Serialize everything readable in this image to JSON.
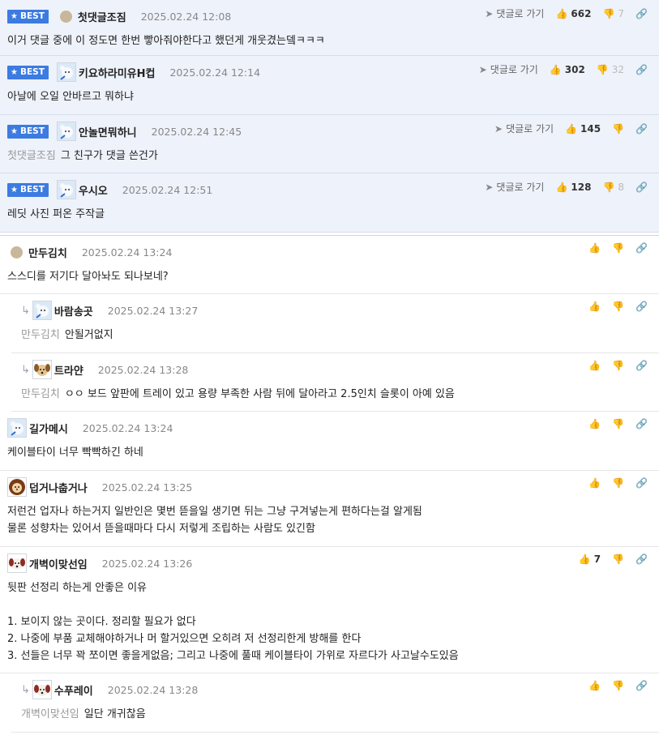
{
  "labels": {
    "best": "BEST",
    "goto": "댓글로 가기"
  },
  "comments": [
    {
      "best": true,
      "avatar": "dot",
      "nick": "첫댓글조짐",
      "date": "2025.02.24 12:08",
      "up": "662",
      "down": "7",
      "text": "이거 댓글 중에 이 정도면 한번 빻아줘야한다고 했던게 개웃겼는뎈ㅋㅋㅋ"
    },
    {
      "best": true,
      "avatar": "bear",
      "nick": "키요하라미유H컵",
      "date": "2025.02.24 12:14",
      "up": "302",
      "down": "32",
      "text": "아날에 오일 안바르고 뭐하냐"
    },
    {
      "best": true,
      "avatar": "bear",
      "nick": "안놀면뭐하니",
      "date": "2025.02.24 12:45",
      "up": "145",
      "down": "",
      "mention": "첫댓글조짐",
      "text": "그 친구가 댓글 쓴건가"
    },
    {
      "best": true,
      "avatar": "bear",
      "nick": "우시오",
      "date": "2025.02.24 12:51",
      "up": "128",
      "down": "8",
      "text": "레딧 사진 퍼온 주작글"
    },
    {
      "avatar": "dot",
      "nick": "만두김치",
      "date": "2025.02.24 13:24",
      "text": "스스디를 저기다 달아놔도 되나보네?"
    },
    {
      "reply": true,
      "avatar": "bear",
      "nick": "바람송곳",
      "date": "2025.02.24 13:27",
      "mention": "만두김치",
      "text": "안될거없지"
    },
    {
      "reply": true,
      "avatar": "dog",
      "nick": "트라얀",
      "date": "2025.02.24 13:28",
      "mention": "만두김치",
      "text": "ㅇㅇ 보드 앞판에 트레이 있고 용량 부족한 사람 뒤에 달아라고 2.5인치 슬롯이 아예 있음"
    },
    {
      "avatar": "bear",
      "nick": "길가메시",
      "date": "2025.02.24 13:24",
      "text": "케이블타이 너무 빡빡하긴 하네"
    },
    {
      "avatar": "lion",
      "nick": "덥거나춥거나",
      "date": "2025.02.24 13:25",
      "text": "저런건 업자나 하는거지 일반인은 몇번 뜯을일 생기면 뒤는 그냥 구겨넣는게 편하다는걸 알게됨\n물론 성향차는 있어서 뜯을때마다 다시 저렇게 조립하는 사람도 있긴함"
    },
    {
      "avatar": "dogr",
      "nick": "개벽이맞선임",
      "date": "2025.02.24 13:26",
      "up": "7",
      "text": "뒷판 선정리 하는게 안좋은 이유\n\n1. 보이지 않는 곳이다. 정리할 필요가 없다\n2. 나중에 부품 교체해야하거나 머 할거있으면 오히려 저 선정리한게 방해를 한다\n3. 선들은 너무 꽉 쪼이면 좋을게없음; 그리고 나중에 풀때 케이블타이 가위로 자르다가 사고날수도있음"
    },
    {
      "reply": true,
      "avatar": "dogr",
      "nick": "수푸레이",
      "date": "2025.02.24 13:28",
      "mention": "개벽이맞선임",
      "text": "일단 개귀찮음"
    }
  ]
}
